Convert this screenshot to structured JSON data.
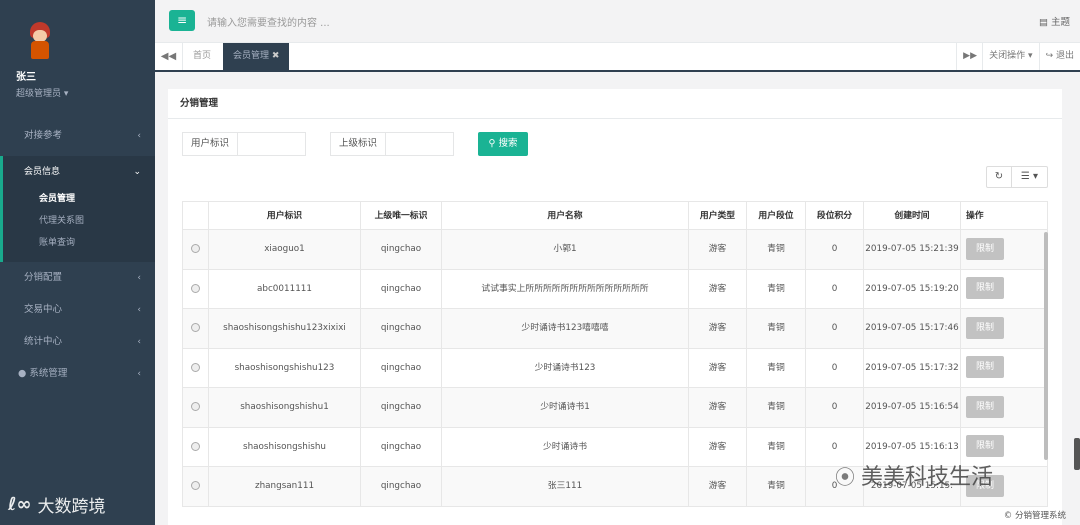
{
  "sidebar": {
    "user_name": "张三",
    "user_role": "超级管理员 ▾",
    "items": [
      {
        "label": "对接参考",
        "chev": "‹"
      },
      {
        "label": "会员信息",
        "chev": "⌄"
      },
      {
        "label": "分销配置",
        "chev": "‹"
      },
      {
        "label": "交易中心",
        "chev": "‹"
      },
      {
        "label": "统计中心",
        "chev": "‹"
      },
      {
        "label": "系统管理",
        "chev": "‹"
      }
    ],
    "sub_items": [
      "会员管理",
      "代理关系图",
      "账单查询"
    ],
    "watermark_text": "大数跨境"
  },
  "topbar": {
    "menu_icon": "≡",
    "search_placeholder": "请输入您需要查找的内容 ...",
    "theme_label": "主题"
  },
  "tabs": {
    "items": [
      "首页",
      "会员管理"
    ],
    "close_actions": "关闭操作 ▾",
    "logout": "退出"
  },
  "panel": {
    "title": "分销管理",
    "filters": {
      "user_id_label": "用户标识",
      "parent_id_label": "上级标识"
    },
    "search_button": "搜索"
  },
  "table": {
    "headers": [
      "用户标识",
      "上级唯一标识",
      "用户名称",
      "用户类型",
      "用户段位",
      "段位积分",
      "创建时间",
      "操作"
    ],
    "action_label": "限制",
    "rows": [
      {
        "uid": "xiaoguo1",
        "parent": "qingchao",
        "name": "小郭1",
        "type": "游客",
        "rank": "青铜",
        "points": "0",
        "created": "2019-07-05 15:21:39"
      },
      {
        "uid": "abc0011111",
        "parent": "qingchao",
        "name": "试试事实上所所所所所所所所所所所所所所",
        "type": "游客",
        "rank": "青铜",
        "points": "0",
        "created": "2019-07-05 15:19:20"
      },
      {
        "uid": "shaoshisongshishu123xixixi",
        "parent": "qingchao",
        "name": "少时诵诗书123嘻嘻嘻",
        "type": "游客",
        "rank": "青铜",
        "points": "0",
        "created": "2019-07-05 15:17:46"
      },
      {
        "uid": "shaoshisongshishu123",
        "parent": "qingchao",
        "name": "少时诵诗书123",
        "type": "游客",
        "rank": "青铜",
        "points": "0",
        "created": "2019-07-05 15:17:32"
      },
      {
        "uid": "shaoshisongshishu1",
        "parent": "qingchao",
        "name": "少时诵诗书1",
        "type": "游客",
        "rank": "青铜",
        "points": "0",
        "created": "2019-07-05 15:16:54"
      },
      {
        "uid": "shaoshisongshishu",
        "parent": "qingchao",
        "name": "少时诵诗书",
        "type": "游客",
        "rank": "青铜",
        "points": "0",
        "created": "2019-07-05 15:16:13"
      },
      {
        "uid": "zhangsan111",
        "parent": "qingchao",
        "name": "张三111",
        "type": "游客",
        "rank": "青铜",
        "points": "0",
        "created": "2019-07-05 15:15:"
      }
    ]
  },
  "watermark": {
    "icon": "⦿",
    "text": "美美科技生活"
  },
  "footer": "© 分销管理系统",
  "colors": {
    "sidebar": "#2f4050",
    "accent": "#1ab394",
    "disabled_button": "#c2c2c2"
  }
}
